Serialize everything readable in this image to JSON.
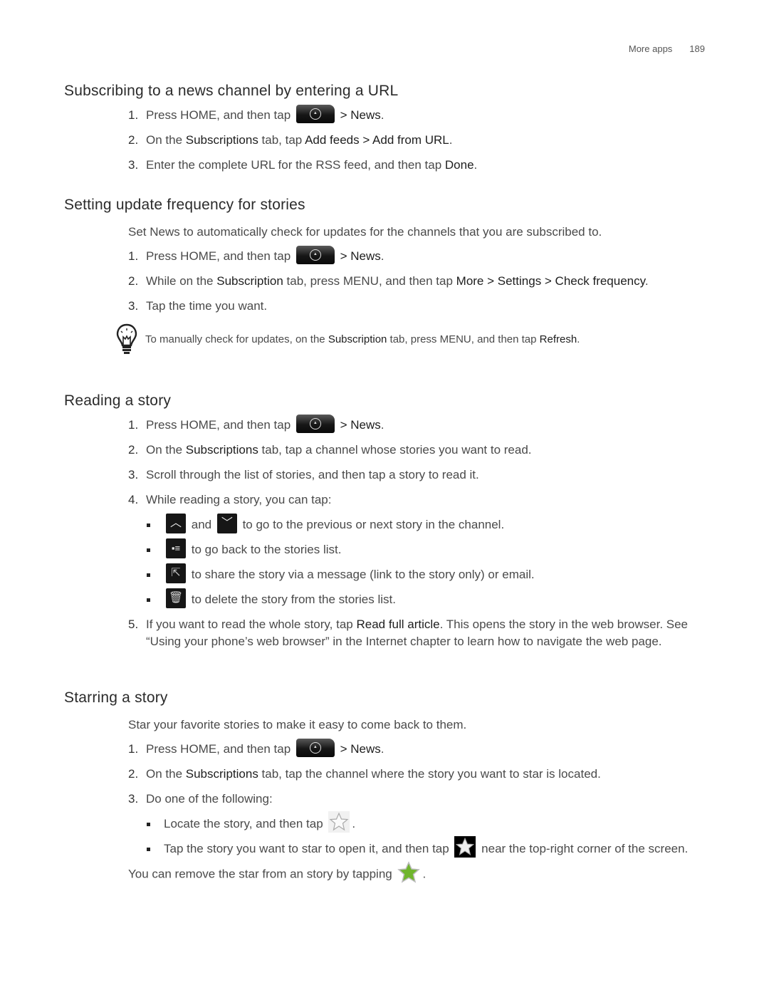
{
  "header": {
    "section": "More apps",
    "page_number": "189"
  },
  "sections": [
    {
      "title": "Subscribing to a news channel by entering a URL",
      "steps": [
        {
          "num": "1.",
          "pre": "Press HOME, and then tap",
          "icon": "all-apps-icon",
          "post_b": "> News",
          "post": "."
        },
        {
          "num": "2.",
          "parts": [
            "On the ",
            "Subscriptions",
            " tab, tap ",
            "Add feeds > Add from URL",
            "."
          ]
        },
        {
          "num": "3.",
          "parts": [
            "Enter the complete URL for the RSS feed, and then tap ",
            "Done",
            "."
          ]
        }
      ]
    },
    {
      "title": "Setting update frequency for stories",
      "intro": "Set News to automatically check for updates for the channels that you are subscribed to.",
      "steps": [
        {
          "num": "1.",
          "pre": "Press HOME, and then tap",
          "icon": "all-apps-icon",
          "post_b": "> News",
          "post": "."
        },
        {
          "num": "2.",
          "parts": [
            "While on the ",
            "Subscription",
            " tab, press MENU, and then tap ",
            "More > Settings > Check frequency",
            "."
          ]
        },
        {
          "num": "3.",
          "text": "Tap the time you want."
        }
      ],
      "tip": {
        "icon": "lightbulb-icon",
        "parts": [
          "To manually check for updates, on the ",
          "Subscription",
          " tab, press MENU, and then tap ",
          "Refresh",
          "."
        ]
      }
    },
    {
      "title": "Reading a story",
      "steps": [
        {
          "num": "1.",
          "pre": "Press HOME, and then tap",
          "icon": "all-apps-icon",
          "post_b": "> News",
          "post": "."
        },
        {
          "num": "2.",
          "parts": [
            "On the ",
            "Subscriptions",
            " tab, tap a channel whose stories you want to read."
          ]
        },
        {
          "num": "3.",
          "text": "Scroll through the list of stories, and then tap a story to read it."
        },
        {
          "num": "4.",
          "text": "While reading a story, you can tap:"
        }
      ],
      "bullets": [
        {
          "icons": [
            "previous-story-icon",
            "next-story-icon"
          ],
          "and": "and",
          "text": "to go to the previous or next story in the channel."
        },
        {
          "icons": [
            "stories-list-icon"
          ],
          "text": "to go back to the stories list."
        },
        {
          "icons": [
            "share-icon"
          ],
          "text": "to share the story via a message (link to the story only) or email."
        },
        {
          "icons": [
            "delete-icon"
          ],
          "text": "to delete the story from the stories list."
        }
      ],
      "step5": {
        "num": "5.",
        "parts": [
          "If you want to read the whole story, tap ",
          "Read full article",
          ". This opens the story in the web browser. See “Using your phone’s web browser” in the Internet chapter to learn how to navigate the web page."
        ]
      }
    },
    {
      "title": "Starring a story",
      "intro": "Star your favorite stories to make it easy to come back to them.",
      "steps": [
        {
          "num": "1.",
          "pre": "Press HOME, and then tap",
          "icon": "all-apps-icon",
          "post_b": "> News",
          "post": "."
        },
        {
          "num": "2.",
          "parts": [
            "On the ",
            "Subscriptions",
            " tab, tap the channel where the story you want to star is located."
          ]
        },
        {
          "num": "3.",
          "text": "Do one of the following:"
        }
      ],
      "bullets": [
        {
          "pre": "Locate the story, and then tap",
          "icon": "star-outline-icon",
          "post": "."
        },
        {
          "pre": "Tap the story you want to star to open it, and then tap",
          "icon": "star-icon",
          "post": "near the top-right corner of the screen."
        }
      ],
      "outro": {
        "pre": "You can remove the star from an story by tapping",
        "icon": "starred-green-icon",
        "post": "."
      }
    }
  ]
}
